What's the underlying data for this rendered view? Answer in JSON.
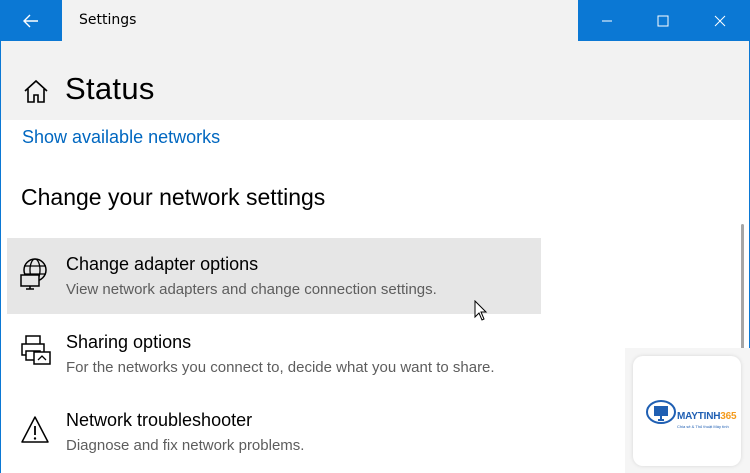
{
  "window": {
    "title": "Settings",
    "back_icon": "back-arrow-icon",
    "controls": [
      "minimize-icon",
      "maximize-icon",
      "close-icon"
    ],
    "accent_color": "#0b78d4"
  },
  "header": {
    "title": "Status",
    "icon": "home-icon",
    "background": "#f2f2f2"
  },
  "content": {
    "link": "Show available networks",
    "link_color": "#0067c0",
    "section_title": "Change your network settings",
    "options": [
      {
        "title": "Change adapter options",
        "description": "View network adapters and change connection settings.",
        "icon": "globe-monitor-icon",
        "hovered": true
      },
      {
        "title": "Sharing options",
        "description": "For the networks you connect to, decide what you want to share.",
        "icon": "sharing-printer-icon",
        "hovered": false
      },
      {
        "title": "Network troubleshooter",
        "description": "Diagnose and fix network problems.",
        "icon": "warning-triangle-icon",
        "hovered": false
      }
    ]
  },
  "watermark": {
    "brand_main": "MAYTINH",
    "brand_accent": "365",
    "tagline": "Chia sẻ & Thủ thuật Máy tính"
  }
}
